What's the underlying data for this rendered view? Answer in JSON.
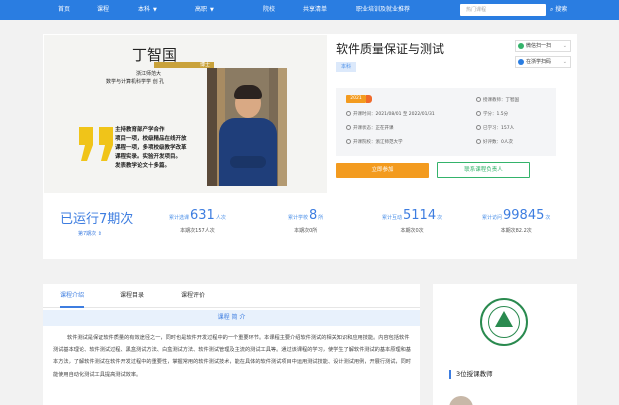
{
  "nav": {
    "items": [
      "首页",
      "课程",
      "本科",
      "高职",
      "院校",
      "共享清单",
      "职业培训及就业推荐"
    ],
    "search_placeholder": "热门课程",
    "search_button": "搜索"
  },
  "cover": {
    "name": "丁智国",
    "rank": "博士",
    "school_line": "浙江师范大",
    "dept_line": "数学与计算机科学学 创 孔",
    "bullets": [
      "主持教育部产学合作",
      "项目一项，校级精品在线开放",
      "课程一项，多项校级教学改革",
      "课程实录。实验开发项目。",
      "发表教学论文十多篇。"
    ]
  },
  "course": {
    "title": "软件质量保证与测试",
    "tag": "本科",
    "share_wechat": "微信扫一扫",
    "share_app": "在浙学扫码",
    "year_badge": "2021",
    "start_label": "开课时间：",
    "start_value": "2021/08/01 至 2022/01/31",
    "status_label": "开课状态：",
    "status_value": "正在开课",
    "school_label": "开课院校：",
    "school_value": "浙江师范大学",
    "teacher_label": "授课教师：",
    "teacher_value": "丁智国",
    "credit_label": "学分：",
    "credit_value": "1.5分",
    "learned_label": "已学习：",
    "learned_value": "157人",
    "rate_label": "好评数：",
    "rate_value": "0人次",
    "join_button": "立即参加",
    "contact_button": "联系课程负责人"
  },
  "stats": {
    "run": "已运行7期次",
    "period": "第7期次",
    "items": [
      {
        "label": "累计选课",
        "value": "631",
        "unit": "人次",
        "sub": "本期次157人次"
      },
      {
        "label": "累计学校",
        "value": "8",
        "unit": "所",
        "sub": "本期次0所"
      },
      {
        "label": "累计互动",
        "value": "5114",
        "unit": "次",
        "sub": "本期次0次"
      },
      {
        "label": "累计访问",
        "value": "99845",
        "unit": "次",
        "sub": "本期次82.2次"
      }
    ]
  },
  "tabs": [
    "课程介绍",
    "课程目录",
    "课程评价"
  ],
  "intro": {
    "heading": "课程 简 介",
    "text": "软件测试是保证软件质量的有效途径之一，同时也是软件开发过程中的一个重要环节。本课程主要介绍软件测试的相关知识和应用技能。内容包括软件测试基本理论、软件测试过程、黑盒测试方法、白盒测试方法、软件测试管理及主流的测试工具等。通过该课程的学习，使学生了解软件测试的基本原理和基本方法，了解软件测试在软件开发过程中的重要性，掌握常用的软件测试技术，能在具体的软件测试项目中运用测试技能、设计测试用例，开展行测试，同时能使用自动化测试工具提高测试效率。"
  },
  "teachers": {
    "count_label": "3位授课教师"
  },
  "colors": {
    "primary": "#2a7de1",
    "accent": "#f39b1f",
    "green": "#34b36b"
  }
}
